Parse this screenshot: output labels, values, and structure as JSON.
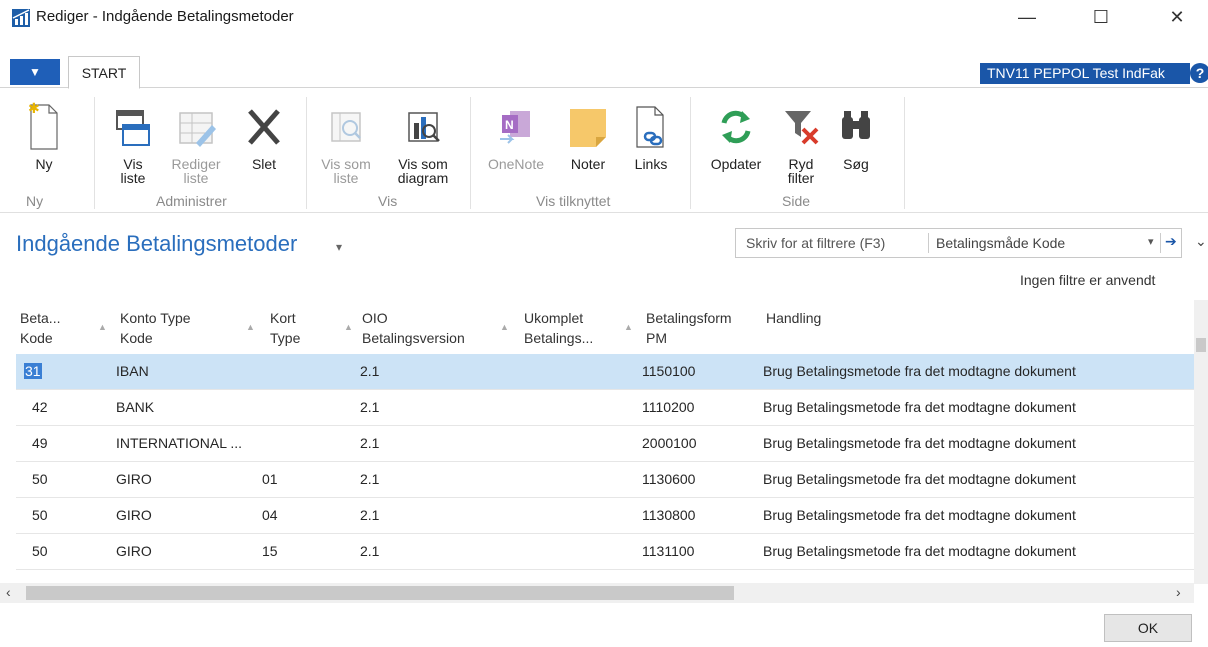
{
  "window": {
    "title": "Rediger - Indgående Betalingsmetoder",
    "minimize": "—",
    "maximize": "☐",
    "close": "✕"
  },
  "tabs": {
    "app_menu": "▼",
    "start": "START"
  },
  "company": {
    "name": "TNV11 PEPPOL Test IndFak",
    "help": "?"
  },
  "ribbon": {
    "new": "Ny",
    "view_list_1": "Vis",
    "view_list_2": "liste",
    "edit_list_1": "Rediger",
    "edit_list_2": "liste",
    "delete": "Slet",
    "show_as_list_1": "Vis som",
    "show_as_list_2": "liste",
    "show_as_chart_1": "Vis som",
    "show_as_chart_2": "diagram",
    "onenote": "OneNote",
    "notes": "Noter",
    "links": "Links",
    "refresh": "Opdater",
    "clear_filter_1": "Ryd",
    "clear_filter_2": "filter",
    "find": "Søg",
    "groups": {
      "new": "Ny",
      "manage": "Administrer",
      "view": "Vis",
      "show_attached": "Vis tilknyttet",
      "page": "Side"
    }
  },
  "page": {
    "title": "Indgående Betalingsmetoder",
    "title_caret": "▾",
    "filter_placeholder": "Skriv for at filtrere (F3)",
    "filter_field": "Betalingsmåde Kode",
    "filter_dropdown": "▾",
    "filter_go": "➔",
    "collapse": "⌄",
    "no_filters": "Ingen filtre er anvendt"
  },
  "columns": {
    "c1_l1": "Beta...",
    "c1_l2": "Kode",
    "c2_l1": "Konto Type",
    "c2_l2": "Kode",
    "c3_l1": "Kort",
    "c3_l2": "Type",
    "c4_l1": "OIO",
    "c4_l2": "Betalingsversion",
    "c5_l1": "Ukomplet",
    "c5_l2": "Betalings...",
    "c6_l1": "Betalingsform",
    "c6_l2": "PM",
    "c7_l1": "Handling",
    "sort_glyph": "▲"
  },
  "rows": [
    {
      "code": "31",
      "account_type": "IBAN",
      "card_type": "",
      "oio_version": "2.1",
      "incomplete": "",
      "pm": "1150100",
      "action": "Brug Betalingsmetode fra det modtagne dokument"
    },
    {
      "code": "42",
      "account_type": "BANK",
      "card_type": "",
      "oio_version": "2.1",
      "incomplete": "",
      "pm": "1110200",
      "action": "Brug Betalingsmetode fra det modtagne dokument"
    },
    {
      "code": "49",
      "account_type": "INTERNATIONAL ...",
      "card_type": "",
      "oio_version": "2.1",
      "incomplete": "",
      "pm": "2000100",
      "action": "Brug Betalingsmetode fra det modtagne dokument"
    },
    {
      "code": "50",
      "account_type": "GIRO",
      "card_type": "01",
      "oio_version": "2.1",
      "incomplete": "",
      "pm": "1130600",
      "action": "Brug Betalingsmetode fra det modtagne dokument"
    },
    {
      "code": "50",
      "account_type": "GIRO",
      "card_type": "04",
      "oio_version": "2.1",
      "incomplete": "",
      "pm": "1130800",
      "action": "Brug Betalingsmetode fra det modtagne dokument"
    },
    {
      "code": "50",
      "account_type": "GIRO",
      "card_type": "15",
      "oio_version": "2.1",
      "incomplete": "",
      "pm": "1131100",
      "action": "Brug Betalingsmetode fra det modtagne dokument"
    }
  ],
  "scroll": {
    "left": "‹",
    "right": "›"
  },
  "ok": "OK",
  "colors": {
    "accent": "#1a56a8",
    "title_blue": "#2a6ebd",
    "selection": "#cce3f6"
  }
}
